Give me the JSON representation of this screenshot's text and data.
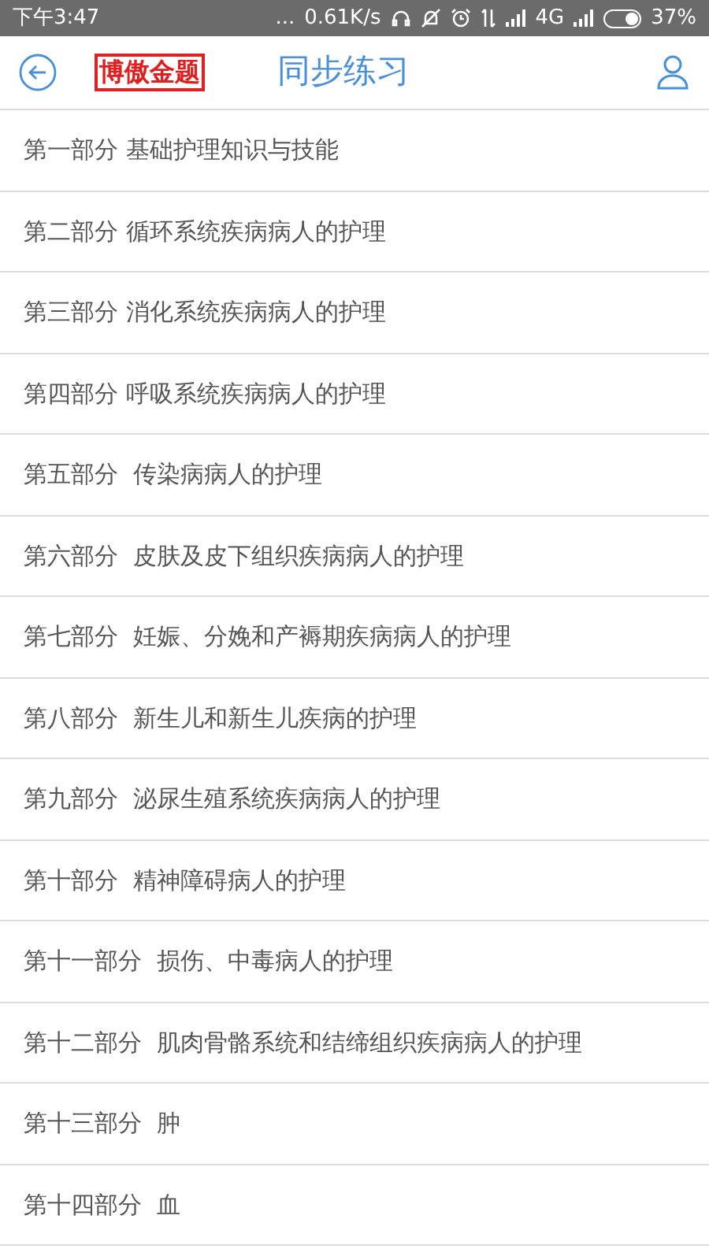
{
  "status_bar": {
    "time": "下午3:47",
    "dots": "...",
    "speed": "0.61K/s",
    "network": "4G",
    "battery_percent": "37%"
  },
  "header": {
    "logo": "博傲金题",
    "title": "同步练习"
  },
  "sections": [
    {
      "label": "第一部分 基础护理知识与技能"
    },
    {
      "label": "第二部分 循环系统疾病病人的护理"
    },
    {
      "label": "第三部分 消化系统疾病病人的护理"
    },
    {
      "label": "第四部分 呼吸系统疾病病人的护理"
    },
    {
      "label": "第五部分  传染病病人的护理"
    },
    {
      "label": "第六部分  皮肤及皮下组织疾病病人的护理"
    },
    {
      "label": "第七部分  妊娠、分娩和产褥期疾病病人的护理"
    },
    {
      "label": "第八部分  新生儿和新生儿疾病的护理"
    },
    {
      "label": "第九部分  泌尿生殖系统疾病病人的护理"
    },
    {
      "label": "第十部分  精神障碍病人的护理"
    },
    {
      "label": "第十一部分  损伤、中毒病人的护理"
    },
    {
      "label": "第十二部分  肌肉骨骼系统和结缔组织疾病病人的护理"
    },
    {
      "label": "第十三部分  肿"
    },
    {
      "label": "第十四部分  血"
    }
  ]
}
